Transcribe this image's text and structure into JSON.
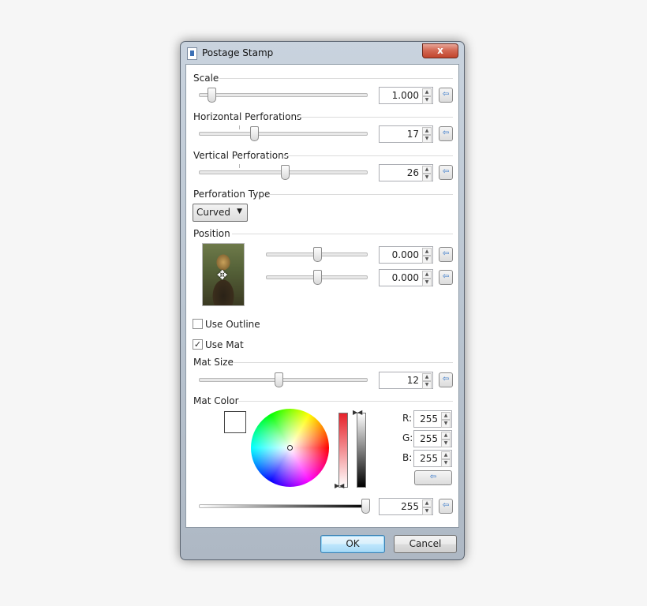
{
  "window": {
    "title": "Postage Stamp",
    "close_label": "x"
  },
  "scale": {
    "label": "Scale",
    "value": "1.000"
  },
  "horizontal_perforations": {
    "label": "Horizontal Perforations",
    "value": "17"
  },
  "vertical_perforations": {
    "label": "Vertical Perforations",
    "value": "26"
  },
  "perforation_type": {
    "label": "Perforation Type",
    "selected": "Curved"
  },
  "position": {
    "label": "Position",
    "x_value": "0.000",
    "y_value": "0.000"
  },
  "use_outline": {
    "label": "Use Outline",
    "checked": false
  },
  "use_mat": {
    "label": "Use Mat",
    "checked": true
  },
  "mat_size": {
    "label": "Mat Size",
    "value": "12"
  },
  "mat_color": {
    "label": "Mat Color",
    "r_label": "R:",
    "r_value": "255",
    "g_label": "G:",
    "g_value": "255",
    "b_label": "B:",
    "b_value": "255",
    "alpha_value": "255",
    "swatch": "#ffffff"
  },
  "buttons": {
    "ok": "OK",
    "cancel": "Cancel"
  },
  "icons": {
    "reset": "reset-arrow-icon",
    "spin": "spin-up-down-icon",
    "move": "move-cursor-icon"
  }
}
